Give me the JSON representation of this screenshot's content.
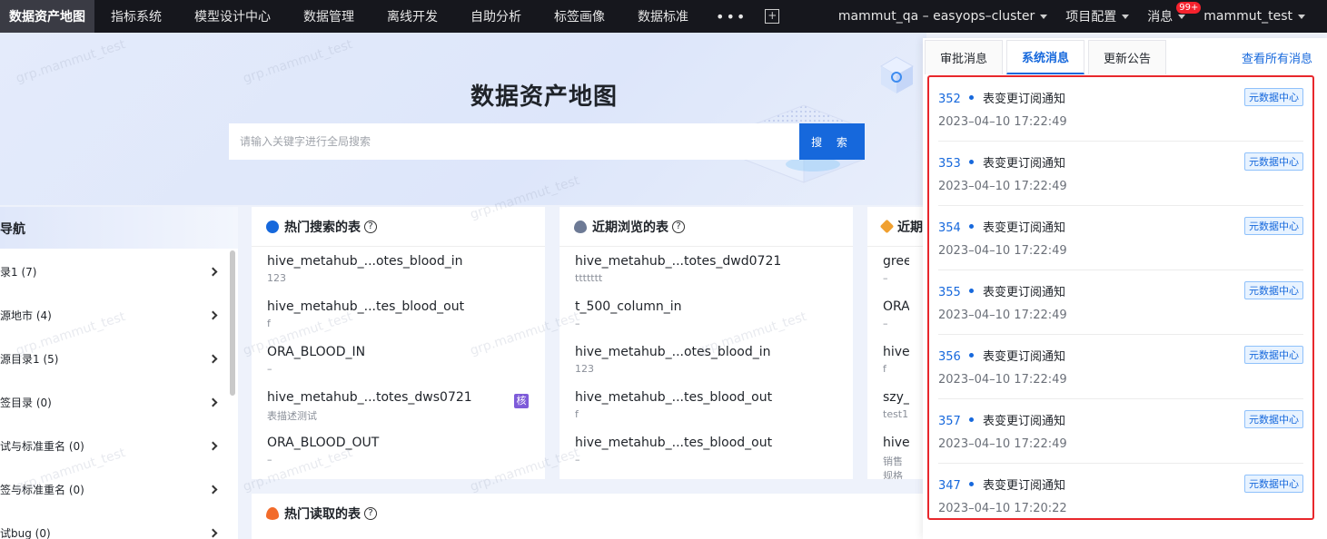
{
  "topnav": {
    "brand": "数据资产地图",
    "items": [
      "指标系统",
      "模型设计中心",
      "数据管理",
      "离线开发",
      "自助分析",
      "标签画像",
      "数据标准"
    ],
    "more": "•••",
    "plus": "+",
    "cluster": "mammut_qa – easyops–cluster",
    "project_config": "项目配置",
    "messages": "消息",
    "badge": "99+",
    "user": "mammut_test"
  },
  "hero": {
    "title": "数据资产地图",
    "search_placeholder": "请输入关键字进行全局搜索",
    "search_button": "搜 索"
  },
  "sidebar": {
    "title": "导航",
    "items": [
      "录1 (7)",
      "源地市 (4)",
      "源目录1 (5)",
      "签目录 (0)",
      "试与标准重名 (0)",
      "签与标准重名 (0)",
      "试bug (0)"
    ]
  },
  "cards": {
    "hot_search": {
      "title": "热门搜索的表",
      "rows": [
        {
          "name": "hive_metahub_...otes_blood_in",
          "desc": "123"
        },
        {
          "name": "hive_metahub_...tes_blood_out",
          "desc": "f"
        },
        {
          "name": "ORA_BLOOD_IN",
          "desc": "–"
        },
        {
          "name": "hive_metahub_...totes_dws0721",
          "desc": "表描述测试",
          "tag": "核"
        },
        {
          "name": "ORA_BLOOD_OUT",
          "desc": "–"
        }
      ]
    },
    "recent_view": {
      "title": "近期浏览的表",
      "rows": [
        {
          "name": "hive_metahub_...totes_dwd0721",
          "desc": "ttttttt"
        },
        {
          "name": "t_500_column_in",
          "desc": "–"
        },
        {
          "name": "hive_metahub_...otes_blood_in",
          "desc": "123"
        },
        {
          "name": "hive_metahub_...tes_blood_out",
          "desc": "f"
        },
        {
          "name": "hive_metahub_...tes_blood_out",
          "desc": "–"
        }
      ]
    },
    "third": {
      "title": "近期",
      "rows": [
        {
          "name": "greenp",
          "desc": "–"
        },
        {
          "name": "ORA_M",
          "desc": "–"
        },
        {
          "name": "hive_m",
          "desc": "f"
        },
        {
          "name": "szy_tes",
          "desc": "test1"
        },
        {
          "name": "hive_sz",
          "desc": "销售规格"
        }
      ]
    },
    "hot_read": {
      "title": "热门读取的表"
    }
  },
  "panel": {
    "tabs": [
      "审批消息",
      "系统消息",
      "更新公告"
    ],
    "active_tab": 1,
    "view_all": "查看所有消息",
    "messages": [
      {
        "id": "352",
        "title": "表变更订阅通知",
        "time": "2023–04–10 17:22:49",
        "tag": "元数据中心"
      },
      {
        "id": "353",
        "title": "表变更订阅通知",
        "time": "2023–04–10 17:22:49",
        "tag": "元数据中心"
      },
      {
        "id": "354",
        "title": "表变更订阅通知",
        "time": "2023–04–10 17:22:49",
        "tag": "元数据中心"
      },
      {
        "id": "355",
        "title": "表变更订阅通知",
        "time": "2023–04–10 17:22:49",
        "tag": "元数据中心"
      },
      {
        "id": "356",
        "title": "表变更订阅通知",
        "time": "2023–04–10 17:22:49",
        "tag": "元数据中心"
      },
      {
        "id": "357",
        "title": "表变更订阅通知",
        "time": "2023–04–10 17:22:49",
        "tag": "元数据中心"
      },
      {
        "id": "347",
        "title": "表变更订阅通知",
        "time": "2023–04–10 17:20:22",
        "tag": "元数据中心"
      }
    ]
  },
  "watermark": "grp.mammut_test",
  "colors": {
    "accent": "#1668dc",
    "highlight_border": "#e8272c",
    "nav_bg": "#16171d"
  }
}
